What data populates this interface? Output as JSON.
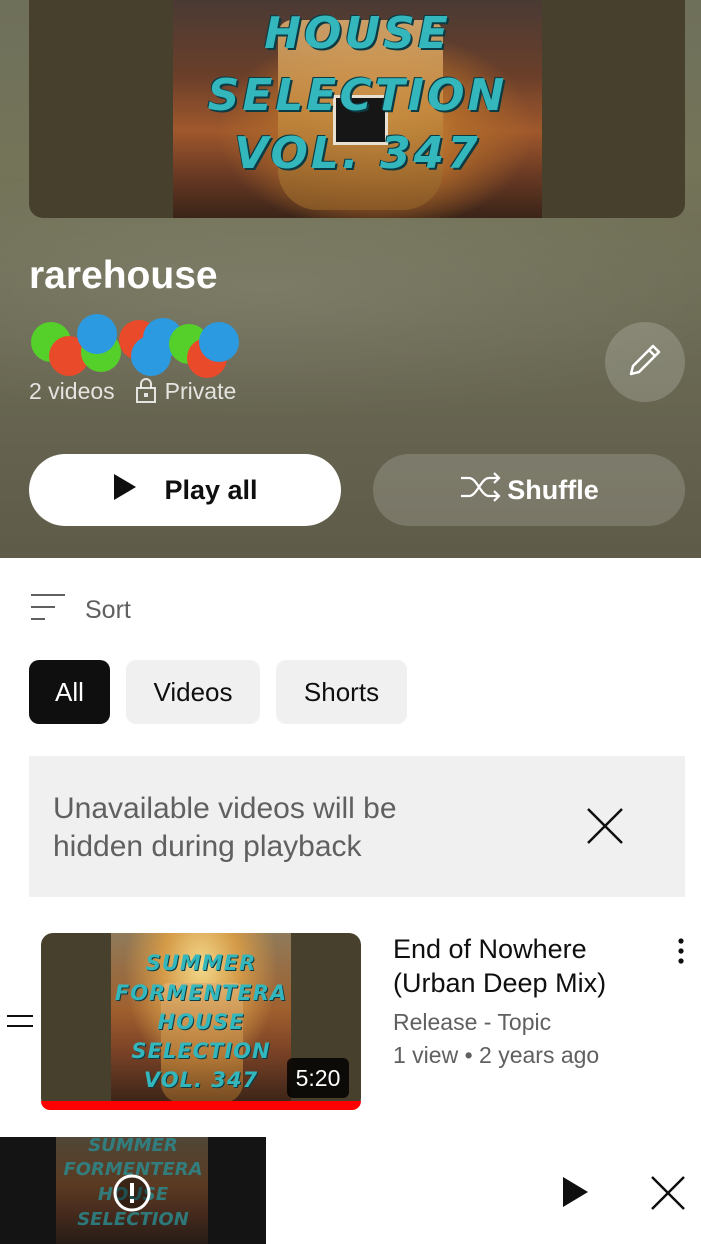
{
  "playlist": {
    "title": "rarehouse",
    "video_count": "2 videos",
    "privacy": "Private",
    "cover_art_lines": [
      "HOUSE",
      "SELECTION",
      "VOL. 347"
    ]
  },
  "actions": {
    "play_all_label": "Play all",
    "shuffle_label": "Shuffle"
  },
  "sort": {
    "label": "Sort"
  },
  "filters": {
    "all_label": "All",
    "videos_label": "Videos",
    "shorts_label": "Shorts",
    "selected": "All"
  },
  "notice": {
    "text": "Unavailable videos will be hidden during playback"
  },
  "videos": [
    {
      "title": "End of Nowhere (Urban Deep Mix)",
      "channel": "Release - Topic",
      "stats": "1 view • 2 years ago",
      "duration": "5:20",
      "watched_fraction": 1.0,
      "thumbnail_lines": [
        "SUMMER",
        "FORMENTERA",
        "HOUSE",
        "SELECTION",
        "VOL. 347"
      ]
    }
  ],
  "mini_player": {
    "thumbnail_lines": [
      "SUMMER",
      "FORMENTERA",
      "HOUSE",
      "SELECTION"
    ]
  },
  "colors": {
    "header_bg": "#6f705a",
    "progress": "#ff0000",
    "chip_selected": "#0f0f0f",
    "chip_default": "#f0f0f0",
    "art_text": "#33b7bd"
  },
  "icons": {
    "play": "play-icon",
    "shuffle": "shuffle-icon",
    "edit": "pencil-icon",
    "lock": "lock-icon",
    "sort": "sort-icon",
    "close": "close-icon",
    "menu": "more-vert-icon",
    "drag": "drag-handle-icon",
    "alert": "alert-circle-icon"
  }
}
